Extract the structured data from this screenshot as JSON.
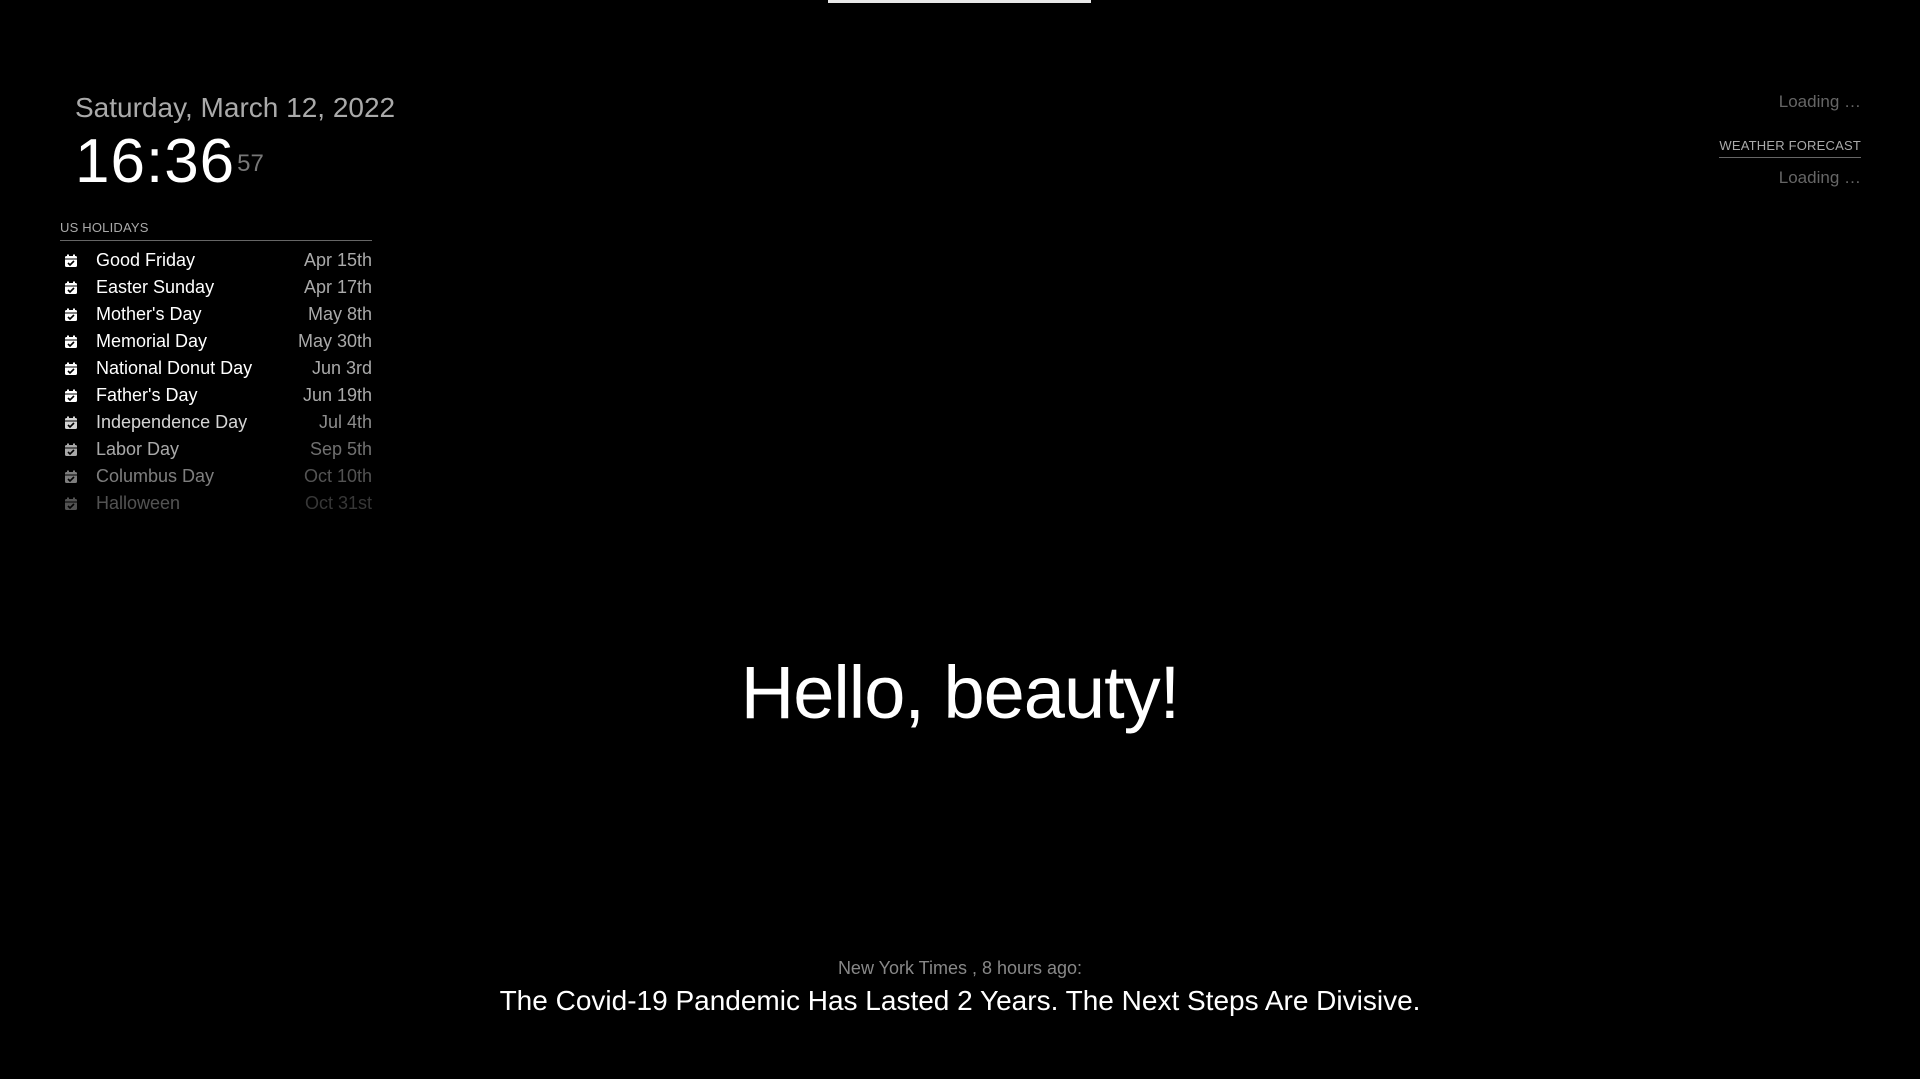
{
  "clock": {
    "date": "Saturday, March 12, 2022",
    "hours_minutes": "16:36",
    "seconds": "57"
  },
  "calendar": {
    "header": "US HOLIDAYS",
    "icon": "calendar-check-icon",
    "events": [
      {
        "title": "Good Friday",
        "date": "Apr 15th"
      },
      {
        "title": "Easter Sunday",
        "date": "Apr 17th"
      },
      {
        "title": "Mother's Day",
        "date": "May 8th"
      },
      {
        "title": "Memorial Day",
        "date": "May 30th"
      },
      {
        "title": "National Donut Day",
        "date": "Jun 3rd"
      },
      {
        "title": "Father's Day",
        "date": "Jun 19th"
      },
      {
        "title": "Independence Day",
        "date": "Jul 4th"
      },
      {
        "title": "Labor Day",
        "date": "Sep 5th"
      },
      {
        "title": "Columbus Day",
        "date": "Oct 10th"
      },
      {
        "title": "Halloween",
        "date": "Oct 31st"
      }
    ]
  },
  "weather": {
    "current_loading": "Loading …",
    "forecast_header": "WEATHER FORECAST",
    "forecast_loading": "Loading …"
  },
  "compliment": {
    "text": "Hello, beauty!"
  },
  "news": {
    "source": "New York Times , 8 hours ago:",
    "headline": "The Covid-19 Pandemic Has Lasted 2 Years. The Next Steps Are Divisive."
  },
  "colors": {
    "background": "#000000",
    "bright": "#ffffff",
    "normal": "#aaaaaa",
    "dimmed": "#666666"
  }
}
